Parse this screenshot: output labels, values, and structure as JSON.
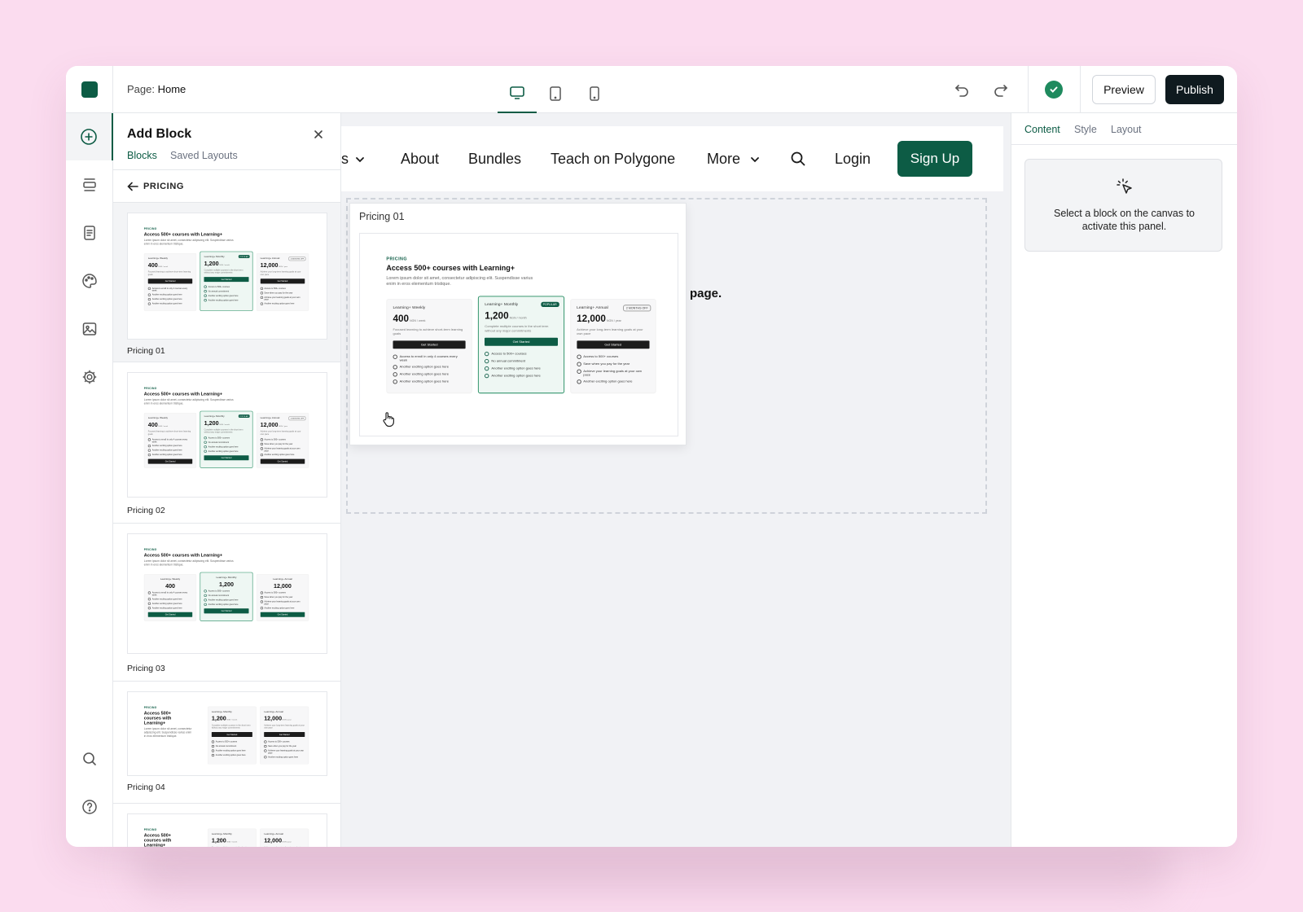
{
  "topbar": {
    "page_prefix": "Page:",
    "page_name": "Home",
    "devices": [
      {
        "icon": "desktop-icon",
        "active": true
      },
      {
        "icon": "tablet-icon",
        "active": false
      },
      {
        "icon": "mobile-icon",
        "active": false
      }
    ],
    "preview_label": "Preview",
    "publish_label": "Publish",
    "saved_status_icon": "check-circle-icon"
  },
  "rail": {
    "items": [
      {
        "icon": "plus-circle-icon",
        "active": true
      },
      {
        "icon": "sections-icon",
        "active": false
      },
      {
        "icon": "pages-icon",
        "active": false
      },
      {
        "icon": "palette-icon",
        "active": false
      },
      {
        "icon": "image-icon",
        "active": false
      },
      {
        "icon": "gear-icon",
        "active": false
      }
    ],
    "bottom_items": [
      {
        "icon": "search-icon"
      },
      {
        "icon": "help-icon"
      }
    ]
  },
  "panel": {
    "title": "Add Block",
    "tabs": [
      {
        "label": "Blocks",
        "active": true
      },
      {
        "label": "Saved Layouts",
        "active": false
      }
    ],
    "back_label": "PRICING",
    "cards": [
      {
        "label": "Pricing 01"
      },
      {
        "label": "Pricing 02"
      },
      {
        "label": "Pricing 03"
      },
      {
        "label": "Pricing 04"
      }
    ]
  },
  "site_nav": {
    "partial_link": "s",
    "links": [
      "About",
      "Bundles",
      "Teach on Polygone",
      "More"
    ],
    "login": "Login",
    "signup": "Sign Up"
  },
  "canvas": {
    "zone_text": "r page.",
    "drag_label": "Pricing 01"
  },
  "pricing_block": {
    "eyebrow": "PRICING",
    "title": "Access 500+ courses with Learning+",
    "desc": "Lorem ipsum dolor sit amet, consectetur adipiscing elit. Suspendisse varius enim in eros elementum tristique.",
    "plans": [
      {
        "name": "Learning+ Weekly",
        "price": "400",
        "unit": "NGN / week",
        "badge": "",
        "desc": "Focused learning to achieve short-term learning goals",
        "cta": "Get Started",
        "features": [
          "Access to enroll in only 4 courses every week",
          "Another exciting option goes here",
          "Another exciting option goes here",
          "Another exciting option goes here"
        ]
      },
      {
        "name": "Learning+ Monthly",
        "price": "1,200",
        "unit": "NGN / month",
        "badge": "POPULAR",
        "desc": "Complete multiple courses in the short term without any major commitments",
        "cta": "Get Started",
        "features": [
          "Access to 500+ courses",
          "No annual commitment",
          "Another exciting option goes here",
          "Another exciting option goes here"
        ]
      },
      {
        "name": "Learning+ Annual",
        "price": "12,000",
        "unit": "NGN / year",
        "badge": "2 MONTHS OFF",
        "desc": "Achieve your long-term learning goals at your own pace",
        "cta": "Get Started",
        "features": [
          "Access to 500+ courses",
          "Save when you pay for the year",
          "Achieve your learning goals at your own pace",
          "Another exciting option goes here"
        ]
      }
    ]
  },
  "right_panel": {
    "tabs": [
      {
        "label": "Content",
        "active": true
      },
      {
        "label": "Style",
        "active": false
      },
      {
        "label": "Layout",
        "active": false
      }
    ],
    "empty_icon": "pointer-click-icon",
    "empty_text": "Select a block on the canvas to activate this panel."
  },
  "colors": {
    "brand": "#0d5c45",
    "background": "#fbdcef",
    "publish_bg": "#0f1a1f",
    "canvas_bg": "#f1f2f5",
    "saved_status": "#1f8a5e"
  }
}
